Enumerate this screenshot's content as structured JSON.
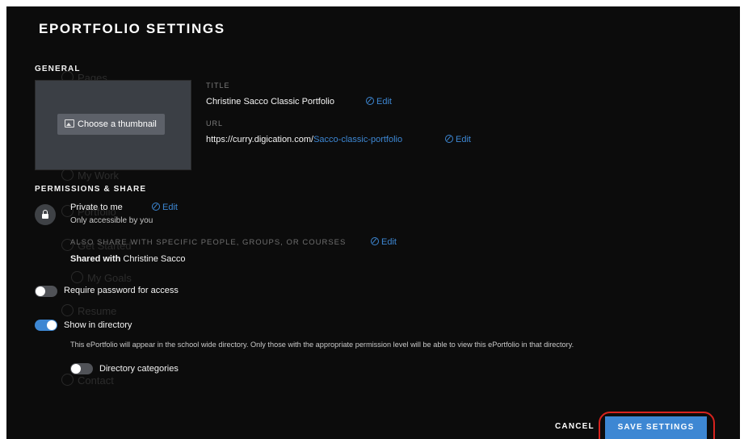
{
  "modal": {
    "title": "EPORTFOLIO SETTINGS"
  },
  "background_nav": {
    "items": [
      "Pages",
      "My Work",
      "Portfolio",
      "Get Started",
      "My Goals",
      "Resume",
      "Contact"
    ]
  },
  "general": {
    "section_label": "GENERAL",
    "thumbnail_button": "Choose a thumbnail",
    "title_label": "TITLE",
    "title_value": "Christine Sacco Classic Portfolio",
    "url_label": "URL",
    "url_base": "https://curry.digication.com/",
    "url_slug": "Sacco-classic-portfolio",
    "edit_label": "Edit"
  },
  "permissions": {
    "section_label": "PERMISSIONS & SHARE",
    "privacy_title": "Private to me",
    "privacy_desc": "Only accessible by you",
    "also_share_label": "ALSO SHARE WITH SPECIFIC PEOPLE, GROUPS, OR COURSES",
    "shared_with_label": "Shared with",
    "shared_with_value": "Christine Sacco",
    "edit_label": "Edit"
  },
  "toggles": {
    "password": {
      "label": "Require password for access",
      "on": false
    },
    "directory": {
      "label": "Show in directory",
      "on": true
    },
    "directory_desc": "This ePortfolio will appear in the school wide directory. Only those with the appropriate permission level will be able to view this ePortfolio in that directory.",
    "categories": {
      "label": "Directory categories",
      "on": false
    }
  },
  "footer": {
    "cancel_label": "CANCEL",
    "save_label": "SAVE SETTINGS"
  },
  "colors": {
    "accent": "#3d87d3",
    "modal_bg": "#0c0c0c",
    "annotation": "#d8231e"
  }
}
